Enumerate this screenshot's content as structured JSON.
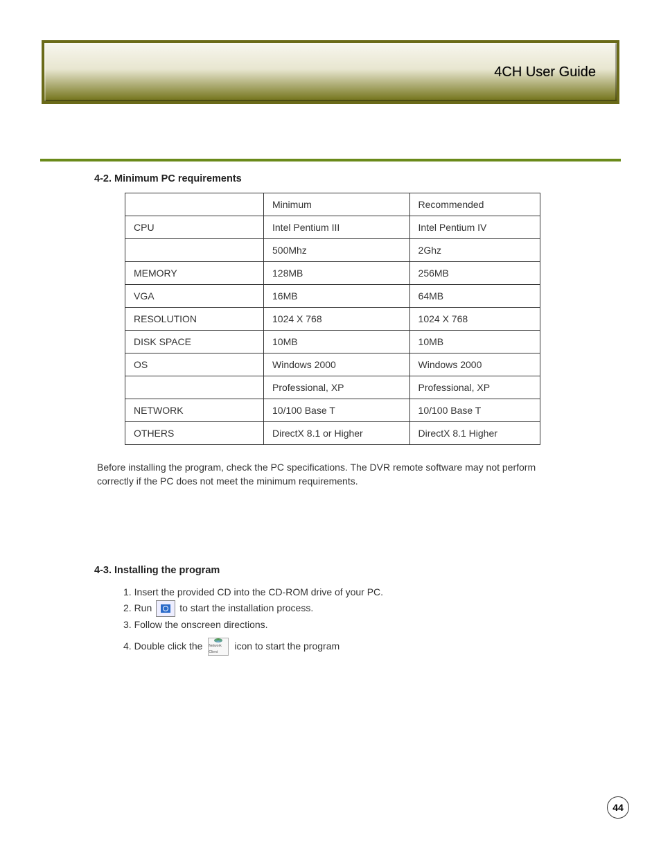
{
  "header": {
    "title": "4CH User Guide"
  },
  "section42": {
    "heading": "4-2. Minimum PC requirements",
    "table": {
      "rows": [
        [
          "",
          "Minimum",
          "Recommended"
        ],
        [
          "CPU",
          "Intel Pentium III",
          "Intel Pentium IV"
        ],
        [
          "",
          "500Mhz",
          "2Ghz"
        ],
        [
          "MEMORY",
          "128MB",
          "256MB"
        ],
        [
          "VGA",
          "16MB",
          "64MB"
        ],
        [
          "RESOLUTION",
          "1024 X 768",
          "1024 X 768"
        ],
        [
          "DISK SPACE",
          "10MB",
          "10MB"
        ],
        [
          "OS",
          "Windows 2000",
          "Windows 2000"
        ],
        [
          "",
          "Professional, XP",
          "Professional, XP"
        ],
        [
          "NETWORK",
          "10/100 Base T",
          "10/100 Base T"
        ],
        [
          "OTHERS",
          "DirectX 8.1 or Higher",
          "DirectX 8.1 Higher"
        ]
      ]
    },
    "note": "Before installing the program, check the PC specifications. The DVR remote software may not perform correctly if the PC does not meet the minimum requirements."
  },
  "section43": {
    "heading": "4-3. Installing the program",
    "steps": {
      "s1": "1. Insert the provided CD into the CD-ROM drive of your PC.",
      "s2a": "2. Run",
      "s2b": "to start the installation process.",
      "s3": "3. Follow the onscreen directions.",
      "s4a": "4. Double click the",
      "s4b": "icon to start the program"
    },
    "icon2_label": "Network Client"
  },
  "page_number": "44"
}
